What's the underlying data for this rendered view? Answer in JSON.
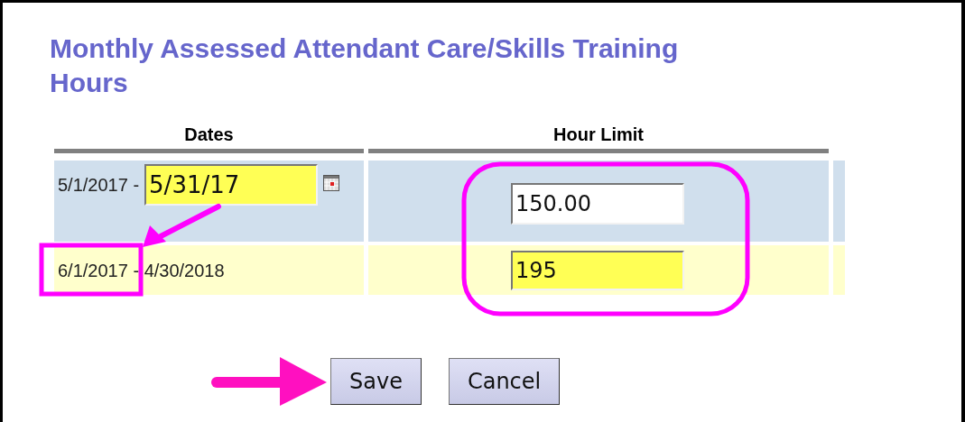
{
  "title": "Monthly Assessed Attendant Care/Skills Training Hours",
  "table": {
    "columns": [
      "Dates",
      "Hour Limit"
    ],
    "rows": [
      {
        "kind": "editable_end",
        "start": "5/1/2017 -",
        "end": {
          "value": "5/31/17",
          "highlighted": true
        },
        "hours": {
          "value": "150.00",
          "highlighted": false
        }
      },
      {
        "kind": "fixed",
        "dates": "6/1/2017 - 4/30/2018",
        "hours": {
          "value": "195",
          "highlighted": true
        }
      }
    ]
  },
  "buttons": [
    "Save",
    "Cancel"
  ]
}
